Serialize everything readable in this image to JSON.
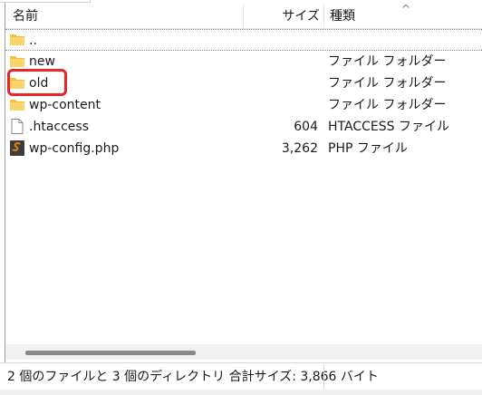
{
  "columns": {
    "name": "名前",
    "size": "サイズ",
    "type": "種類",
    "sort_indicator": "^"
  },
  "files": [
    {
      "name": "..",
      "size": "",
      "type": "",
      "icon": "folder-icon"
    },
    {
      "name": "new",
      "size": "",
      "type": "ファイル フォルダー",
      "icon": "folder-icon"
    },
    {
      "name": "old",
      "size": "",
      "type": "ファイル フォルダー",
      "icon": "folder-icon"
    },
    {
      "name": "wp-content",
      "size": "",
      "type": "ファイル フォルダー",
      "icon": "folder-icon"
    },
    {
      "name": ".htaccess",
      "size": "604",
      "type": "HTACCESS ファイル",
      "icon": "document-icon"
    },
    {
      "name": "wp-config.php",
      "size": "3,262",
      "type": "PHP ファイル",
      "icon": "php-file-icon"
    }
  ],
  "status": "2 個のファイルと 3 個のディレクトリ 合計サイズ: 3,866 バイト",
  "colors": {
    "highlight": "#e8262b",
    "folder": "#f5c242",
    "php_icon": "#e07b16"
  }
}
